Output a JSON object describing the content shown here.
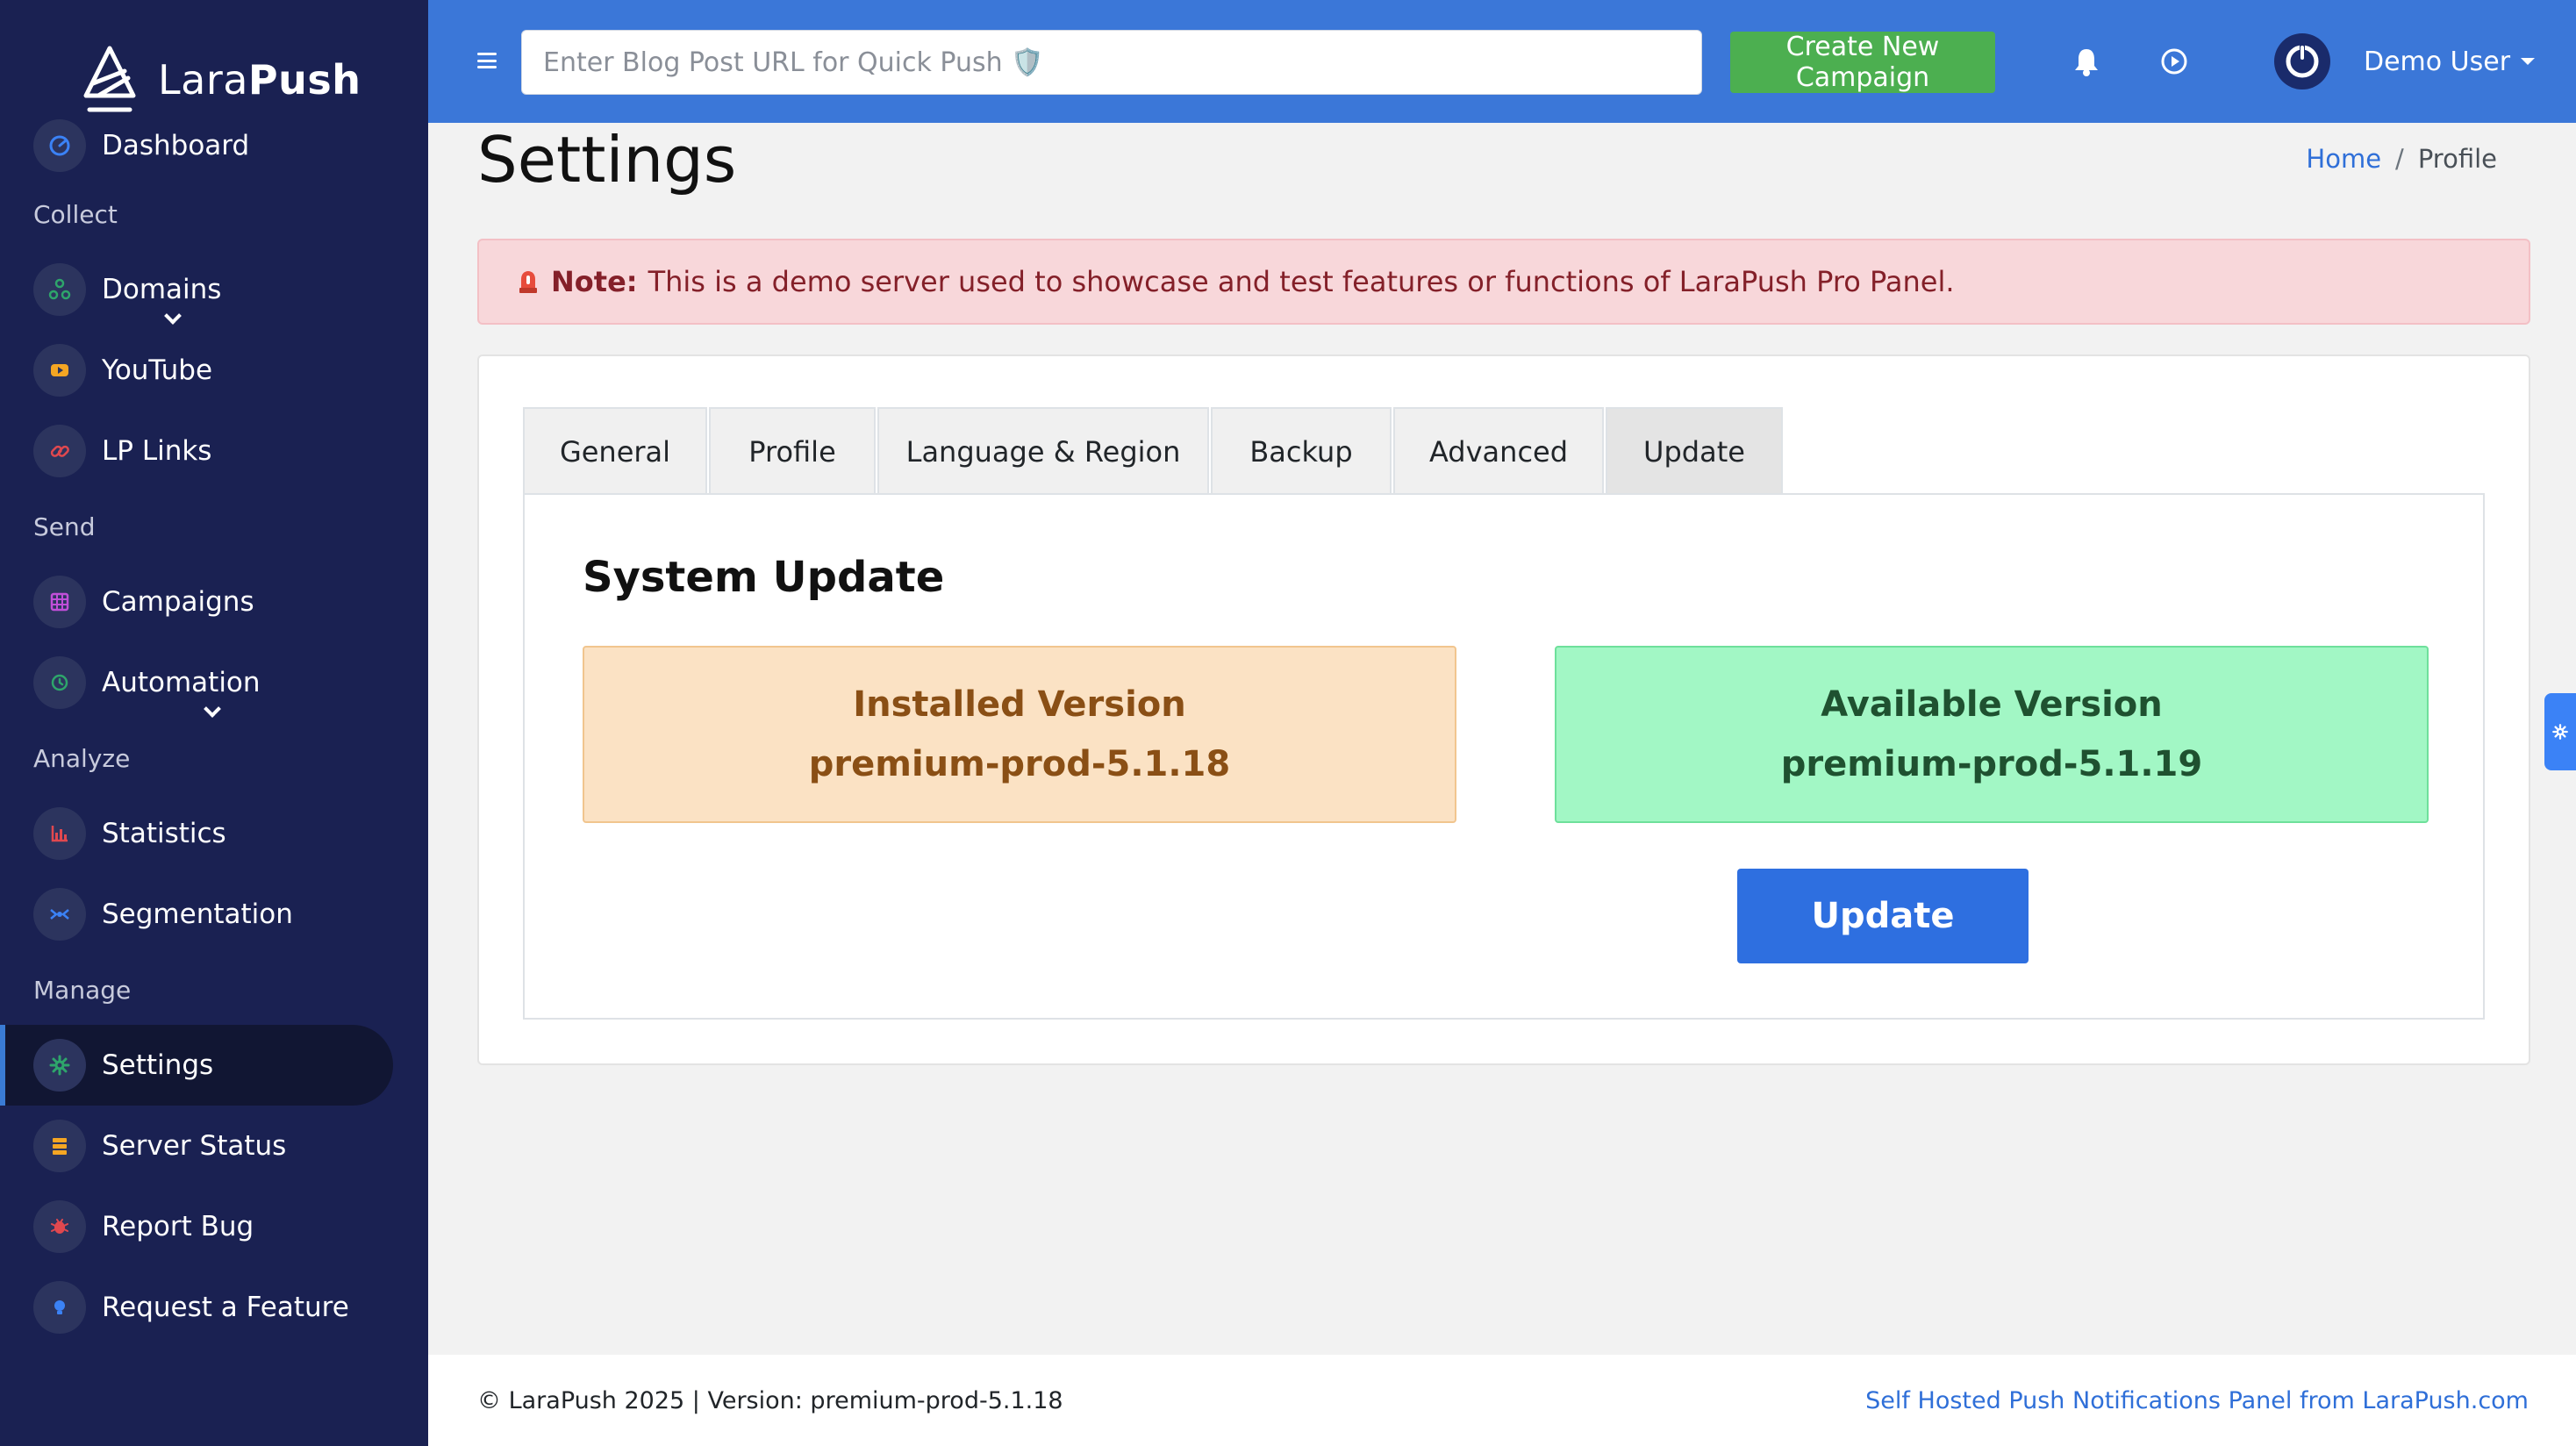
{
  "brand": {
    "name_light": "Lara",
    "name_bold": "Push"
  },
  "sidebar": {
    "items": [
      {
        "label": "Dashboard",
        "icon": "dashboard-icon",
        "icon_color": "#3b82f6"
      },
      {
        "section": "Collect"
      },
      {
        "label": "Domains",
        "icon": "domains-icon",
        "icon_color": "#2ea56b",
        "has_submenu": true
      },
      {
        "label": "YouTube",
        "icon": "youtube-icon",
        "icon_color": "#f5a623"
      },
      {
        "label": "LP Links",
        "icon": "link-icon",
        "icon_color": "#e0484f"
      },
      {
        "section": "Send"
      },
      {
        "label": "Campaigns",
        "icon": "campaigns-icon",
        "icon_color": "#c04fd8"
      },
      {
        "label": "Automation",
        "icon": "automation-icon",
        "icon_color": "#2ea56b",
        "has_submenu": true
      },
      {
        "section": "Analyze"
      },
      {
        "label": "Statistics",
        "icon": "statistics-icon",
        "icon_color": "#e0484f"
      },
      {
        "label": "Segmentation",
        "icon": "segmentation-icon",
        "icon_color": "#3b82f6"
      },
      {
        "section": "Manage"
      },
      {
        "label": "Settings",
        "icon": "gear-icon",
        "icon_color": "#2ea56b",
        "active": true
      },
      {
        "label": "Server Status",
        "icon": "server-icon",
        "icon_color": "#f5a623"
      },
      {
        "label": "Report Bug",
        "icon": "bug-icon",
        "icon_color": "#e0484f"
      },
      {
        "label": "Request a Feature",
        "icon": "lightbulb-icon",
        "icon_color": "#3b82f6"
      }
    ]
  },
  "topbar": {
    "search_placeholder": "Enter Blog Post URL for Quick Push 🛡️",
    "create_button": "Create New Campaign",
    "user_name": "Demo User"
  },
  "page": {
    "title": "Settings",
    "breadcrumb": {
      "home": "Home",
      "separator": "/",
      "current": "Profile"
    }
  },
  "alert": {
    "label": "Note:",
    "text": "This is a demo server used to showcase and test features or functions of LaraPush Pro Panel."
  },
  "tabs": [
    {
      "label": "General",
      "width": 0
    },
    {
      "label": "Profile"
    },
    {
      "label": "Language & Region"
    },
    {
      "label": "Backup"
    },
    {
      "label": "Advanced"
    },
    {
      "label": "Update",
      "active": true
    }
  ],
  "update_panel": {
    "title": "System Update",
    "installed": {
      "heading": "Installed Version",
      "version": "premium-prod-5.1.18"
    },
    "available": {
      "heading": "Available Version",
      "version": "premium-prod-5.1.19"
    },
    "button": "Update"
  },
  "footer": {
    "left": "© LaraPush 2025 | Version: premium-prod-5.1.18",
    "right": "Self Hosted Push Notifications Panel from LaraPush.com"
  },
  "colors": {
    "sidebar_bg": "#1a2152",
    "topbar_bg": "#3b77d8",
    "create_button_bg": "#4caf50",
    "update_button_bg": "#2e6fe0",
    "alert_bg": "#f8d7da",
    "installed_bg": "#fbe2c4",
    "available_bg": "#a2f7c5"
  }
}
